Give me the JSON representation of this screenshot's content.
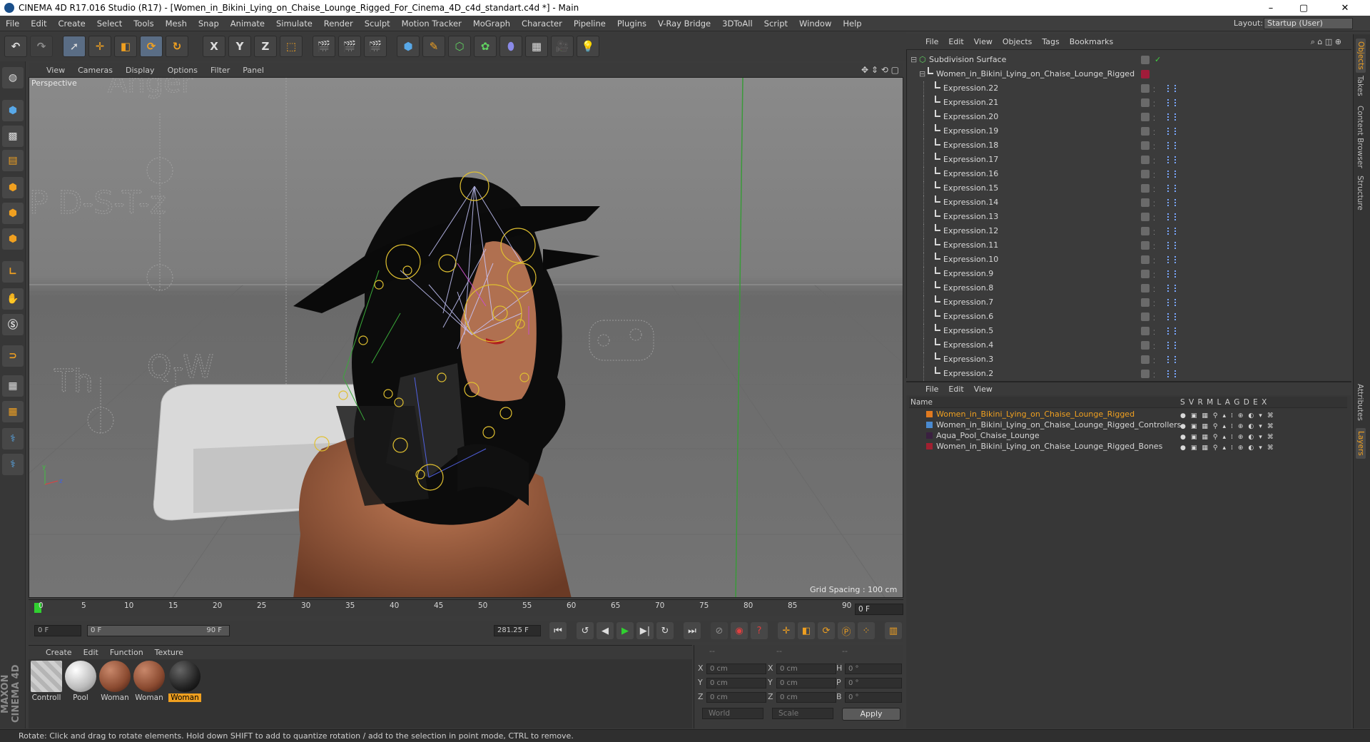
{
  "window": {
    "title": "CINEMA 4D R17.016 Studio (R17) - [Women_in_Bikini_Lying_on_Chaise_Lounge_Rigged_For_Cinema_4D_c4d_standart.c4d *] - Main",
    "controls": [
      "–",
      "▢",
      "✕"
    ]
  },
  "menubar": {
    "items": [
      "File",
      "Edit",
      "Create",
      "Select",
      "Tools",
      "Mesh",
      "Snap",
      "Animate",
      "Simulate",
      "Render",
      "Sculpt",
      "Motion Tracker",
      "MoGraph",
      "Character",
      "Pipeline",
      "Plugins",
      "V-Ray Bridge",
      "3DToAll",
      "Script",
      "Window",
      "Help"
    ],
    "layout_label": "Layout:",
    "layout_value": "Startup (User)"
  },
  "toolbar": {
    "axis_x": "X",
    "axis_y": "Y",
    "axis_z": "Z"
  },
  "viewport": {
    "menu": [
      "View",
      "Cameras",
      "Display",
      "Options",
      "Filter",
      "Panel"
    ],
    "label": "Perspective",
    "grid_spacing": "Grid Spacing : 100 cm",
    "overlay_texts": [
      "Anger",
      "P  D-S-T-z",
      "Th",
      "Q-W"
    ]
  },
  "timeline": {
    "ticks": [
      "0",
      "5",
      "10",
      "15",
      "20",
      "25",
      "30",
      "35",
      "40",
      "45",
      "50",
      "55",
      "60",
      "65",
      "70",
      "75",
      "80",
      "85",
      "90"
    ],
    "current_frame": "0 F",
    "start_field": "0 F",
    "range_start": "0 F",
    "range_end": "90 F",
    "fps_field": "281.25 F"
  },
  "materials": {
    "menu": [
      "Create",
      "Edit",
      "Function",
      "Texture"
    ],
    "items": [
      {
        "label": "Controll",
        "color": "#c9c9c9"
      },
      {
        "label": "Pool",
        "color": "#e4e4e4"
      },
      {
        "label": "Woman",
        "color": "#8a4a30"
      },
      {
        "label": "Woman",
        "color": "#8a4a30"
      },
      {
        "label": "Woman",
        "color": "#222222"
      }
    ],
    "selected_index": 4
  },
  "coordinates": {
    "header": [
      "--",
      "--",
      "--"
    ],
    "rows": [
      {
        "l1": "X",
        "v1": "0 cm",
        "l2": "X",
        "v2": "0 cm",
        "l3": "H",
        "v3": "0 °"
      },
      {
        "l1": "Y",
        "v1": "0 cm",
        "l2": "Y",
        "v2": "0 cm",
        "l3": "P",
        "v3": "0 °"
      },
      {
        "l1": "Z",
        "v1": "0 cm",
        "l2": "Z",
        "v2": "0 cm",
        "l3": "B",
        "v3": "0 °"
      }
    ],
    "world": "World",
    "scale": "Scale",
    "apply": "Apply"
  },
  "status": "Rotate: Click and drag to rotate elements. Hold down SHIFT to add to quantize rotation / add to the selection in point mode, CTRL to remove.",
  "objects": {
    "menu": [
      "File",
      "Edit",
      "View",
      "Objects",
      "Tags",
      "Bookmarks"
    ],
    "root": "Subdivision Surface",
    "child": "Women_in_Bikini_Lying_on_Chaise_Lounge_Rigged",
    "expressions": [
      "Expression.22",
      "Expression.21",
      "Expression.20",
      "Expression.19",
      "Expression.18",
      "Expression.17",
      "Expression.16",
      "Expression.15",
      "Expression.14",
      "Expression.13",
      "Expression.12",
      "Expression.11",
      "Expression.10",
      "Expression.9",
      "Expression.8",
      "Expression.7",
      "Expression.6",
      "Expression.5",
      "Expression.4",
      "Expression.3",
      "Expression.2"
    ]
  },
  "layers": {
    "menu": [
      "File",
      "Edit",
      "View"
    ],
    "header_name": "Name",
    "header_flags": "S V R M L A G D E X",
    "rows": [
      {
        "name": "Women_in_Bikini_Lying_on_Chaise_Lounge_Rigged",
        "color": "#e07a20",
        "highlight": true
      },
      {
        "name": "Women_in_Bikini_Lying_on_Chaise_Lounge_Rigged_Controllers",
        "color": "#4a8ad0",
        "highlight": false
      },
      {
        "name": "Aqua_Pool_Chaise_Lounge",
        "color": "#3a2040",
        "highlight": false
      },
      {
        "name": "Women_in_Bikini_Lying_on_Chaise_Lounge_Rigged_Bones",
        "color": "#a02030",
        "highlight": false
      }
    ]
  },
  "right_tabs": [
    "Objects",
    "Takes",
    "Content Browser",
    "Structure",
    "Attributes",
    "Layers"
  ]
}
